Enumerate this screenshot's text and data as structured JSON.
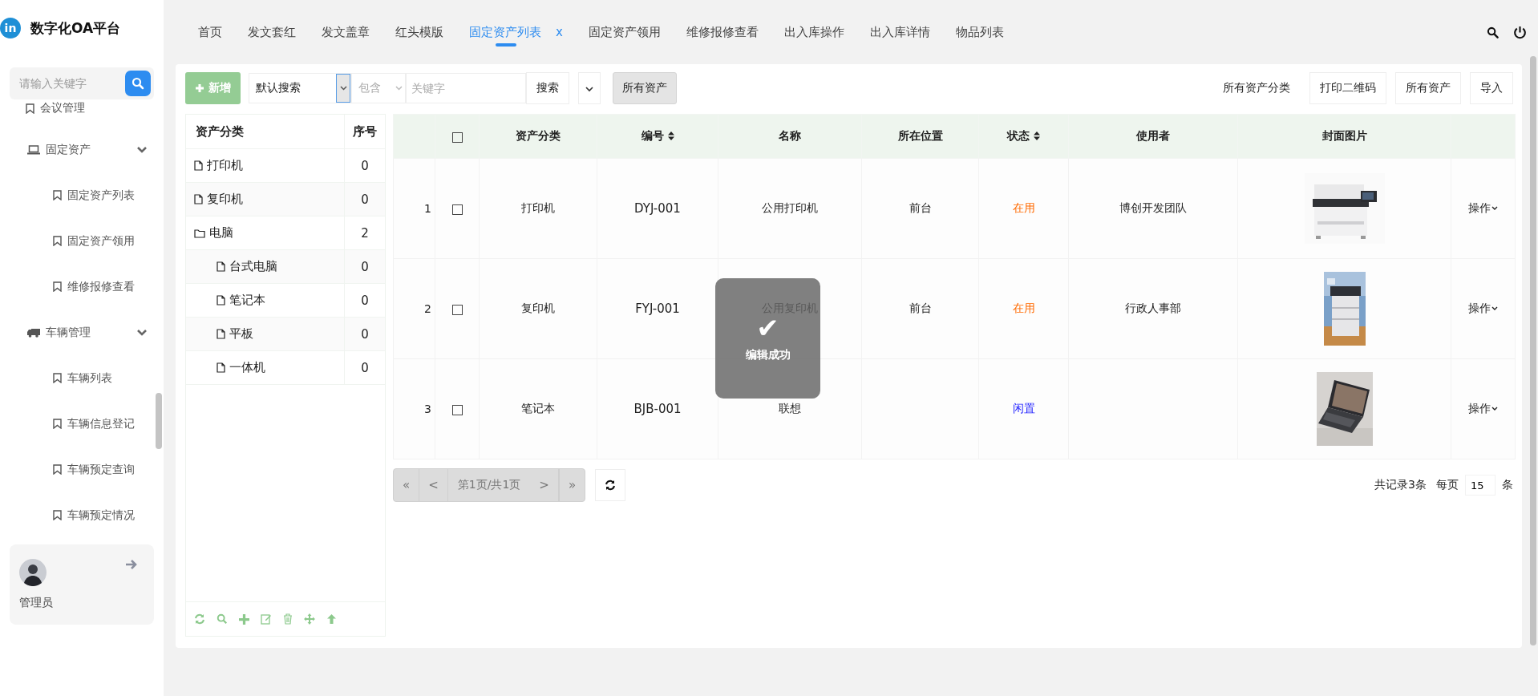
{
  "app": {
    "logo": "in",
    "title": "数字化OA平台"
  },
  "sidebar": {
    "search_placeholder": "请输入关键字",
    "items": [
      {
        "label": "会议管理",
        "kind": "leaf"
      },
      {
        "label": "固定资产",
        "kind": "group",
        "expanded": true,
        "children": [
          {
            "label": "固定资产列表"
          },
          {
            "label": "固定资产领用"
          },
          {
            "label": "维修报修查看"
          }
        ]
      },
      {
        "label": "车辆管理",
        "kind": "group",
        "expanded": true,
        "children": [
          {
            "label": "车辆列表"
          },
          {
            "label": "车辆信息登记"
          },
          {
            "label": "车辆预定查询"
          },
          {
            "label": "车辆预定情况"
          }
        ]
      }
    ],
    "user": {
      "name": "管理员"
    }
  },
  "tabs": [
    {
      "label": "首页",
      "selected": false
    },
    {
      "label": "发文套红",
      "selected": false
    },
    {
      "label": "发文盖章",
      "selected": false
    },
    {
      "label": "红头模版",
      "selected": false
    },
    {
      "label": "固定资产列表",
      "selected": true,
      "close": "x"
    },
    {
      "label": "固定资产领用",
      "selected": false
    },
    {
      "label": "维修报修查看",
      "selected": false
    },
    {
      "label": "出入库操作",
      "selected": false
    },
    {
      "label": "出入库详情",
      "selected": false
    },
    {
      "label": "物品列表",
      "selected": false
    }
  ],
  "toolbar": {
    "add": "新增",
    "search_mode": "默认搜索",
    "match": "包含",
    "keyword_placeholder": "关键字",
    "search": "搜索",
    "all_assets": "所有资产",
    "right": [
      "所有资产分类",
      "打印二维码",
      "所有资产",
      "导入"
    ]
  },
  "tree": {
    "columns": [
      "资产分类",
      "序号"
    ],
    "nodes": [
      {
        "label": "打印机",
        "order": "0",
        "kind": "file"
      },
      {
        "label": "复印机",
        "order": "0",
        "kind": "file"
      },
      {
        "label": "电脑",
        "order": "2",
        "kind": "folder",
        "children": [
          {
            "label": "台式电脑",
            "order": "0",
            "kind": "file"
          },
          {
            "label": "笔记本",
            "order": "0",
            "kind": "file"
          },
          {
            "label": "平板",
            "order": "0",
            "kind": "file"
          },
          {
            "label": "一体机",
            "order": "0",
            "kind": "file"
          }
        ]
      }
    ]
  },
  "table": {
    "columns": [
      {
        "label": "资产分类",
        "sortable": false
      },
      {
        "label": "编号",
        "sortable": true
      },
      {
        "label": "名称",
        "sortable": false
      },
      {
        "label": "所在位置",
        "sortable": false
      },
      {
        "label": "状态",
        "sortable": true
      },
      {
        "label": "使用者",
        "sortable": false
      },
      {
        "label": "封面图片",
        "sortable": false
      }
    ],
    "header_checked": false,
    "rows": [
      {
        "index": "1",
        "checked": false,
        "category": "打印机",
        "code": "DYJ-001",
        "name": "公用打印机",
        "location": "前台",
        "status": "在用",
        "color": "#ff6a00",
        "user": "博创开发团队",
        "action": "操作"
      },
      {
        "index": "2",
        "checked": false,
        "category": "复印机",
        "code": "FYJ-001",
        "name": "公用复印机",
        "location": "前台",
        "status": "在用",
        "color": "#ff6a00",
        "user": "行政人事部",
        "action": "操作"
      },
      {
        "index": "3",
        "checked": false,
        "category": "笔记本",
        "code": "BJB-001",
        "name": "联想",
        "status": "闲置",
        "color": "#1a1aff",
        "action": "操作"
      }
    ]
  },
  "pagination": {
    "first": "«",
    "prev": "<",
    "page": "第1页/共1页",
    "next": ">",
    "last": "»",
    "total": "共记录3条",
    "per_page_label": "每页",
    "per_page": "15",
    "unit": "条"
  },
  "toast": {
    "icon": "✔",
    "text": "编辑成功"
  }
}
